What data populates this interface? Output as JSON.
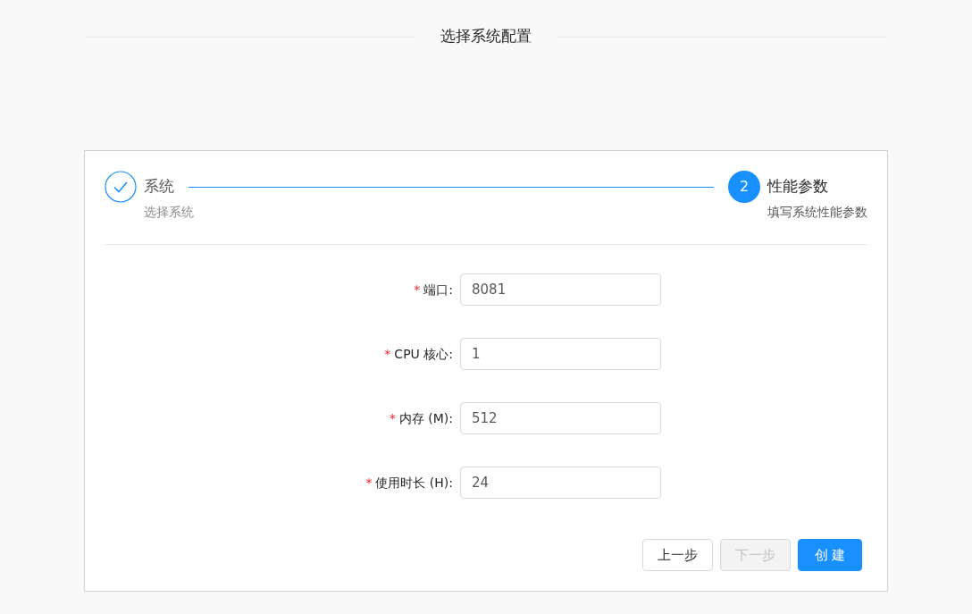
{
  "page_title": "选择系统配置",
  "steps": [
    {
      "title": "系统",
      "description": "选择系统",
      "kind": "finish"
    },
    {
      "title": "性能参数",
      "description": "填写系统性能参数",
      "kind": "process",
      "number": "2"
    }
  ],
  "form": {
    "fields": [
      {
        "label": "端口:",
        "required": true,
        "required_mark": "*",
        "value": "8081"
      },
      {
        "label": "CPU 核心:",
        "required": true,
        "required_mark": "*",
        "value": "1"
      },
      {
        "label": "内存 (M):",
        "required": true,
        "required_mark": "*",
        "value": "512"
      },
      {
        "label": "使用时长 (H):",
        "required": true,
        "required_mark": "*",
        "value": "24"
      }
    ]
  },
  "buttons": [
    {
      "label": "上一步",
      "kind": "default",
      "disabled": false
    },
    {
      "label": "下一步",
      "kind": "default",
      "disabled": true
    },
    {
      "label": "创 建",
      "kind": "primary",
      "disabled": false
    }
  ]
}
